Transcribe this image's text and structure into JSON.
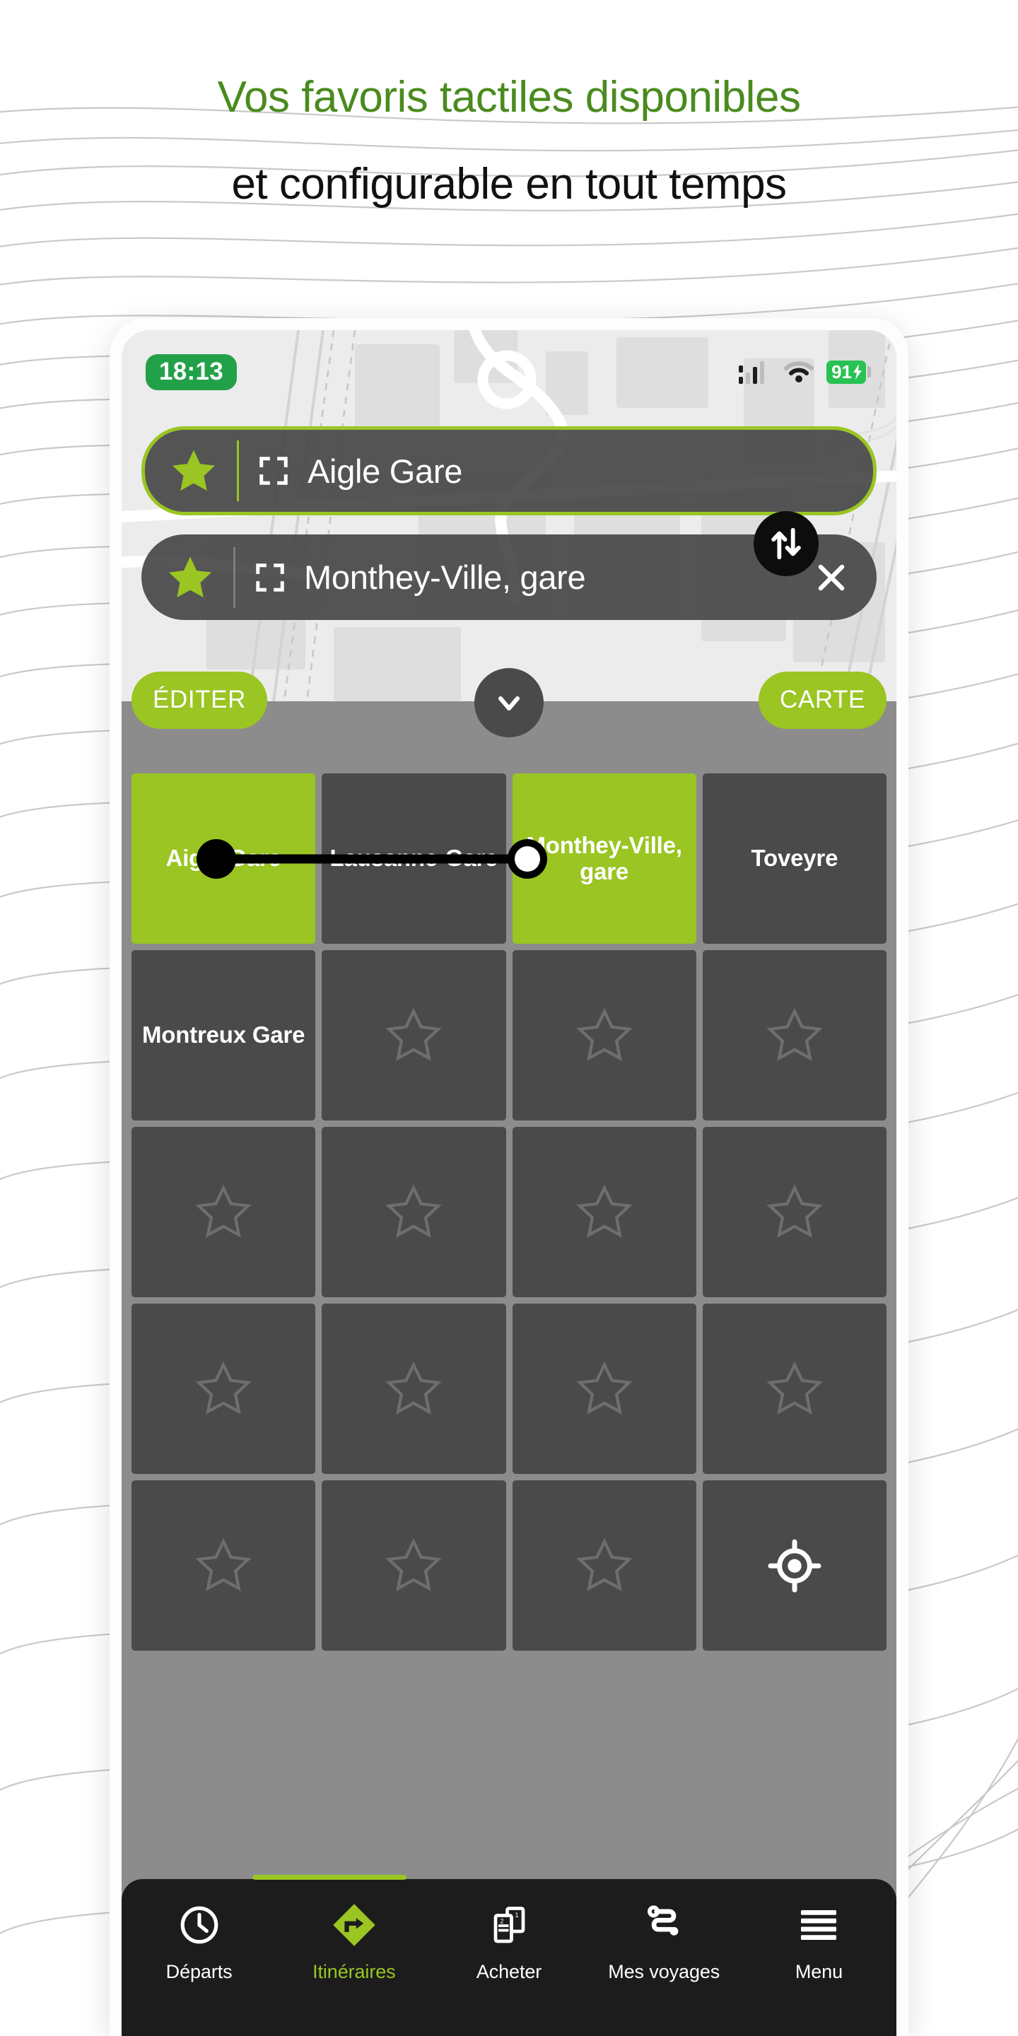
{
  "page": {
    "headline_green": "Vos favoris tactiles disponibles",
    "headline_black": "et configurable en tout temps",
    "accent_green": "#9ac523",
    "heading_green": "#4a8b1e",
    "tile_dark": "#4a4a4a",
    "grid_gap_grey": "#8c8c8c",
    "nav_dark": "#1c1c1c"
  },
  "status_bar": {
    "time": "18:13",
    "battery_percent": "91",
    "battery_icon": "battery-charging-icon",
    "wifi_icon": "wifi-icon",
    "signal_icon": "cellular-signal-icon"
  },
  "search": {
    "origin": {
      "value": "Aigle Gare",
      "favorite_icon": "star-filled-icon",
      "locate_icon": "viewfinder-bracket-icon",
      "is_selected": true
    },
    "destination": {
      "value": "Monthey-Ville, gare",
      "favorite_icon": "star-filled-icon",
      "locate_icon": "viewfinder-bracket-icon",
      "clear_icon": "close-x-icon",
      "is_selected": false
    },
    "swap_icon": "swap-vertical-arrows-icon"
  },
  "action_bar": {
    "edit_label": "ÉDITER",
    "map_label": "CARTE",
    "collapse_icon": "chevron-down-icon"
  },
  "favorites_grid": {
    "columns": 4,
    "rows": 5,
    "empty_icon": "star-outline-icon",
    "locate_icon": "my-location-crosshair-icon",
    "tiles": [
      {
        "label": "Aigle Gare",
        "state": "active"
      },
      {
        "label": "Lausanne-Gare",
        "state": "filled"
      },
      {
        "label": "Monthey-Ville, gare",
        "state": "active"
      },
      {
        "label": "Toveyre",
        "state": "filled"
      },
      {
        "label": "Montreux Gare",
        "state": "filled"
      },
      {
        "label": "",
        "state": "empty"
      },
      {
        "label": "",
        "state": "empty"
      },
      {
        "label": "",
        "state": "empty"
      },
      {
        "label": "",
        "state": "empty"
      },
      {
        "label": "",
        "state": "empty"
      },
      {
        "label": "",
        "state": "empty"
      },
      {
        "label": "",
        "state": "empty"
      },
      {
        "label": "",
        "state": "empty"
      },
      {
        "label": "",
        "state": "empty"
      },
      {
        "label": "",
        "state": "empty"
      },
      {
        "label": "",
        "state": "empty"
      },
      {
        "label": "",
        "state": "empty"
      },
      {
        "label": "",
        "state": "empty"
      },
      {
        "label": "",
        "state": "empty"
      },
      {
        "label": "",
        "state": "locate"
      }
    ],
    "route_overlay": {
      "from_tile_index": 0,
      "to_tile_index": 2,
      "from_marker": "filled-dot",
      "to_marker": "hollow-dot"
    }
  },
  "bottom_nav": {
    "active_index": 1,
    "items": [
      {
        "label": "Départs",
        "icon": "clock-icon"
      },
      {
        "label": "Itinéraires",
        "icon": "route-diamond-arrow-icon"
      },
      {
        "label": "Acheter",
        "icon": "tickets-icon"
      },
      {
        "label": "Mes voyages",
        "icon": "journey-path-icon"
      },
      {
        "label": "Menu",
        "icon": "hamburger-menu-icon"
      }
    ]
  }
}
